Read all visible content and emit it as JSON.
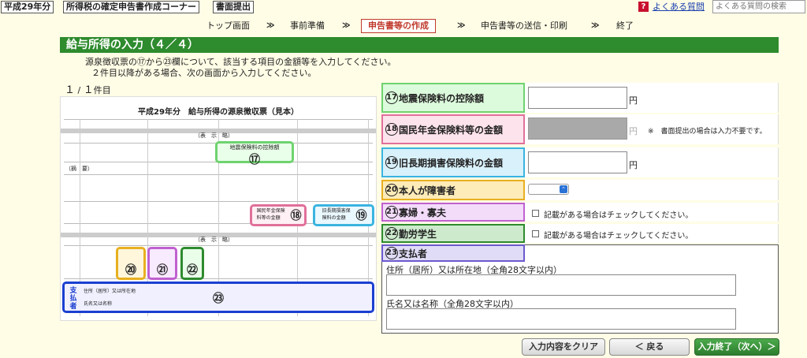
{
  "header": {
    "year_tab": "平成29年分",
    "corner_title": "所得税の確定申告書作成コーナー",
    "submit_method": "書面提出",
    "faq_label": "よくある質問",
    "faq_search_placeholder": "よくある質問の検索",
    "help_glyph": "?"
  },
  "steps": [
    {
      "label": "トップ画面"
    },
    {
      "label": "事前準備"
    },
    {
      "label": "申告書等の作成"
    },
    {
      "label": "申告書等の送信・印刷"
    },
    {
      "label": "終了"
    }
  ],
  "step_separator": "≫",
  "active_step_index": 2,
  "page": {
    "title": "給与所得の入力（４／４）",
    "instruction1": "源泉徴収票の⑰から㉓欄について、該当する項目の金額等を入力してください。",
    "instruction2": "２件目以降がある場合、次の画面から入力してください。",
    "count_current": "１",
    "count_sep": " / ",
    "count_total": "１",
    "count_suffix": "件目"
  },
  "slip": {
    "title": "平成29年分　給与所得の源泉徴収票（見本）",
    "row_label_omitted": "（摘　要）",
    "row_label_omitted2": "（表　示　略）",
    "payer_side_label": "支払者",
    "payer_address_label": "住所（居所）又は所在地",
    "payer_name_label": "氏名又は名称",
    "mark_17_caption": "地震保険料の控除額",
    "mark_18_caption": "国民年金保険料等の金額",
    "mark_19_caption": "旧長期損害保険料の金額",
    "mark_20_caption": "本人が障害者",
    "mark_21_caption": "寡婦",
    "mark_22_caption": "勤労学生",
    "marks": [
      "⑰",
      "⑱",
      "⑲",
      "⑳",
      "㉑",
      "㉒",
      "㉓"
    ]
  },
  "form": {
    "field17": {
      "num": "17",
      "label": "地震保険料の控除額",
      "value": "",
      "unit": "円"
    },
    "field18": {
      "num": "18",
      "label": "国民年金保険料等の金額",
      "value": "",
      "unit": "円",
      "note": "※　書面提出の場合は入力不要です。"
    },
    "field19": {
      "num": "19",
      "label": "旧長期損害保険料の金額",
      "value": "",
      "unit": "円"
    },
    "field20": {
      "num": "20",
      "label": "本人が障害者",
      "selected": ""
    },
    "field21": {
      "num": "21",
      "label": "寡婦・寡夫",
      "checkbox_label": "記載がある場合はチェックしてください。"
    },
    "field22": {
      "num": "22",
      "label": "勤労学生",
      "checkbox_label": "記載がある場合はチェックしてください。"
    },
    "field23": {
      "num": "23",
      "label": "支払者",
      "address_label": "住所（居所）又は所在地（全角28文字以内）",
      "address_value": "",
      "name_label": "氏名又は名称（全角28文字以内）",
      "name_value": ""
    }
  },
  "buttons": {
    "clear": "入力内容をクリア",
    "back": "＜ 戻る",
    "next": "入力終了（次へ）＞"
  },
  "colors": {
    "green_bar": "#2e8b2e",
    "accent_red": "#c0392b",
    "mark17": "#6fd36f",
    "mark18": "#e0709a",
    "mark19": "#3ab4e0",
    "mark20": "#e8b020",
    "mark21": "#c060d0",
    "mark22": "#2e8b2e",
    "mark23": "#1a3fd0"
  }
}
